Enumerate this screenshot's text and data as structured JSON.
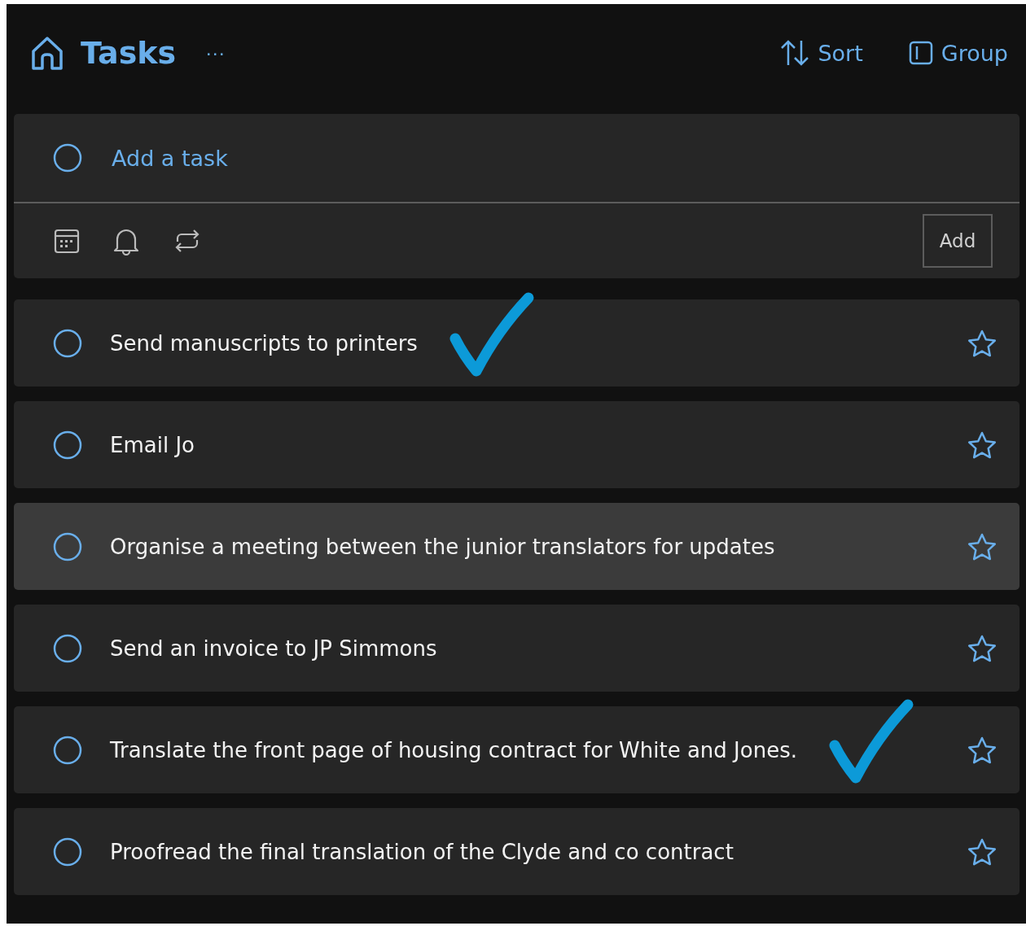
{
  "header": {
    "title": "Tasks",
    "more": "···",
    "sort": "Sort",
    "group": "Group"
  },
  "add_task": {
    "placeholder": "Add a task",
    "button": "Add"
  },
  "tasks": [
    {
      "text": "Send manuscripts to printers",
      "selected": false,
      "annotated": true
    },
    {
      "text": "Email Jo",
      "selected": false,
      "annotated": false
    },
    {
      "text": "Organise a meeting between the junior translators for updates",
      "selected": true,
      "annotated": false
    },
    {
      "text": "Send an invoice to JP Simmons",
      "selected": false,
      "annotated": false
    },
    {
      "text": "Translate the front page of housing contract for White and Jones.",
      "selected": false,
      "annotated": true
    },
    {
      "text": "Proofread the final translation of the Clyde and co contract",
      "selected": false,
      "annotated": false
    }
  ]
}
